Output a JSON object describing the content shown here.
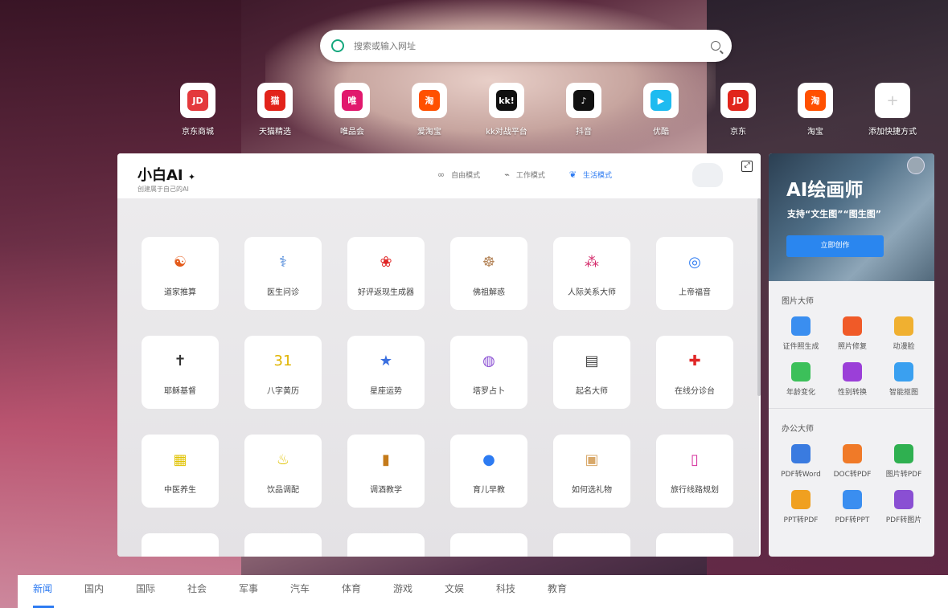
{
  "search": {
    "placeholder": "搜索或输入网址"
  },
  "shortcuts": [
    {
      "label": "京东商城",
      "icon": "jd-mall-icon",
      "glyph": "JD",
      "color": "#e4393c"
    },
    {
      "label": "天猫精选",
      "icon": "tmall-icon",
      "glyph": "猫",
      "color": "#e2231a"
    },
    {
      "label": "唯品会",
      "icon": "vip-icon",
      "glyph": "唯",
      "color": "#e1186d"
    },
    {
      "label": "爱淘宝",
      "icon": "aitaobao-icon",
      "glyph": "淘",
      "color": "#ff5000"
    },
    {
      "label": "kk对战平台",
      "icon": "kk-icon",
      "glyph": "kk!",
      "color": "#111111"
    },
    {
      "label": "抖音",
      "icon": "douyin-icon",
      "glyph": "♪",
      "color": "#111111"
    },
    {
      "label": "优酷",
      "icon": "youku-icon",
      "glyph": "▶",
      "color": "#1ebbf0"
    },
    {
      "label": "京东",
      "icon": "jd-icon",
      "glyph": "JD",
      "color": "#e1251b"
    },
    {
      "label": "淘宝",
      "icon": "taobao-icon",
      "glyph": "淘",
      "color": "#ff5000"
    },
    {
      "label": "添加快捷方式",
      "icon": "add-icon",
      "glyph": "+",
      "color": "#ffffff"
    }
  ],
  "panel": {
    "brand": "小白AI",
    "brand_sub": "创建属于自己的AI",
    "modes": [
      {
        "label": "自由模式",
        "icon": "infinity-icon",
        "glyph": "∞"
      },
      {
        "label": "工作模式",
        "icon": "chart-icon",
        "glyph": "⌁"
      },
      {
        "label": "生活模式",
        "icon": "leaf-icon",
        "glyph": "❦"
      }
    ],
    "cards": [
      {
        "label": "道家推算",
        "icon": "taiji-icon",
        "glyph": "☯",
        "color": "#e45b1b"
      },
      {
        "label": "医生问诊",
        "icon": "doctor-icon",
        "glyph": "⚕",
        "color": "#3a7bd5"
      },
      {
        "label": "好评返现生成器",
        "icon": "tulip-icon",
        "glyph": "❀",
        "color": "#e02626"
      },
      {
        "label": "佛祖解惑",
        "icon": "buddha-icon",
        "glyph": "☸",
        "color": "#b5865b"
      },
      {
        "label": "人际关系大师",
        "icon": "network-icon",
        "glyph": "⁂",
        "color": "#d42b6b"
      },
      {
        "label": "上帝福音",
        "icon": "globe-icon",
        "glyph": "◎",
        "color": "#2d7bf2"
      },
      {
        "label": "耶稣基督",
        "icon": "jesus-icon",
        "glyph": "✝",
        "color": "#333333"
      },
      {
        "label": "八字黄历",
        "icon": "calendar-icon",
        "glyph": "31",
        "color": "#e0b400"
      },
      {
        "label": "星座运势",
        "icon": "star-icon",
        "glyph": "★",
        "color": "#3a6fe0"
      },
      {
        "label": "塔罗占卜",
        "icon": "crystal-ball-icon",
        "glyph": "◍",
        "color": "#8a4fd3"
      },
      {
        "label": "起名大师",
        "icon": "id-card-icon",
        "glyph": "▤",
        "color": "#444444"
      },
      {
        "label": "在线分诊台",
        "icon": "medical-pin-icon",
        "glyph": "✚",
        "color": "#e02626"
      },
      {
        "label": "中医养生",
        "icon": "gift-box-icon",
        "glyph": "▦",
        "color": "#e0c200"
      },
      {
        "label": "饮品调配",
        "icon": "drink-icon",
        "glyph": "♨",
        "color": "#e0c200"
      },
      {
        "label": "调酒教学",
        "icon": "bottle-icon",
        "glyph": "▮",
        "color": "#c47a1a"
      },
      {
        "label": "育儿早教",
        "icon": "pacifier-icon",
        "glyph": "●",
        "color": "#2d7bf2"
      },
      {
        "label": "如何选礼物",
        "icon": "present-icon",
        "glyph": "▣",
        "color": "#d8a86a"
      },
      {
        "label": "旅行线路规划",
        "icon": "luggage-icon",
        "glyph": "▯",
        "color": "#d42b9b"
      }
    ]
  },
  "side": {
    "banner_title": "AI绘画师",
    "banner_sub": "支持“文生图”“图生图”",
    "banner_button": "立即创作",
    "sections": [
      {
        "title": "图片大师",
        "tools": [
          {
            "label": "证件照生成",
            "icon": "id-photo-icon",
            "color": "#3a8ef0"
          },
          {
            "label": "照片修复",
            "icon": "photo-repair-icon",
            "color": "#f05a28"
          },
          {
            "label": "动漫脸",
            "icon": "anime-face-icon",
            "color": "#f0b030"
          },
          {
            "label": "年龄变化",
            "icon": "age-change-icon",
            "color": "#3cc05a"
          },
          {
            "label": "性别转换",
            "icon": "gender-icon",
            "color": "#9b3fd8"
          },
          {
            "label": "智能抠图",
            "icon": "cutout-icon",
            "color": "#3aa0f0"
          }
        ]
      },
      {
        "title": "办公大师",
        "tools": [
          {
            "label": "PDF转Word",
            "icon": "pdf-word-icon",
            "color": "#3a7be0"
          },
          {
            "label": "DOC转PDF",
            "icon": "doc-pdf-icon",
            "color": "#f07a28"
          },
          {
            "label": "图片转PDF",
            "icon": "image-pdf-icon",
            "color": "#2fb050"
          },
          {
            "label": "PPT转PDF",
            "icon": "ppt-pdf-icon",
            "color": "#f0a020"
          },
          {
            "label": "PDF转PPT",
            "icon": "pdf-ppt-icon",
            "color": "#3a8ef0"
          },
          {
            "label": "PDF转图片",
            "icon": "pdf-image-icon",
            "color": "#8a4fd3"
          }
        ]
      }
    ]
  },
  "news_tabs": [
    "新闻",
    "国内",
    "国际",
    "社会",
    "军事",
    "汽车",
    "体育",
    "游戏",
    "文娱",
    "科技",
    "教育"
  ],
  "colors": {
    "accent": "#2d7bf2"
  }
}
